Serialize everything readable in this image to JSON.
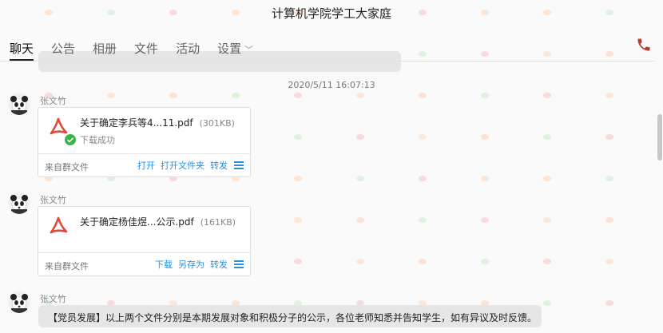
{
  "window": {
    "title": "计算机学院学工大家庭"
  },
  "tabs": [
    {
      "label": "聊天",
      "active": true
    },
    {
      "label": "公告"
    },
    {
      "label": "相册"
    },
    {
      "label": "文件"
    },
    {
      "label": "活动"
    },
    {
      "label": "设置"
    }
  ],
  "chat": {
    "timestamp": "2020/5/11 16:07:13",
    "messages": [
      {
        "sender": "张文竹",
        "file": {
          "name": "关于确定李兵等4...11.pdf",
          "size": "(301KB)",
          "status": "下载成功",
          "source": "来自群文件",
          "actions": [
            "打开",
            "打开文件夹",
            "转发"
          ]
        }
      },
      {
        "sender": "张文竹",
        "file": {
          "name": "关于确定杨佳煜...公示.pdf",
          "size": "(161KB)",
          "source": "来自群文件",
          "actions": [
            "下载",
            "另存为",
            "转发"
          ]
        }
      },
      {
        "sender": "张文竹",
        "text": "【党员发展】以上两个文件分别是本期发展对象和积极分子的公示，各位老师知悉并告知学生，如有异议及时反馈。"
      }
    ]
  },
  "icons": {
    "phone": "phone-icon",
    "pdf": "pdf-icon",
    "check": "check-icon",
    "menu": "menu-icon"
  },
  "colors": {
    "accent_link": "#2a8fd8",
    "pdf_red": "#e2483a",
    "success_green": "#3bb54a",
    "phone_red": "#c0392b"
  }
}
